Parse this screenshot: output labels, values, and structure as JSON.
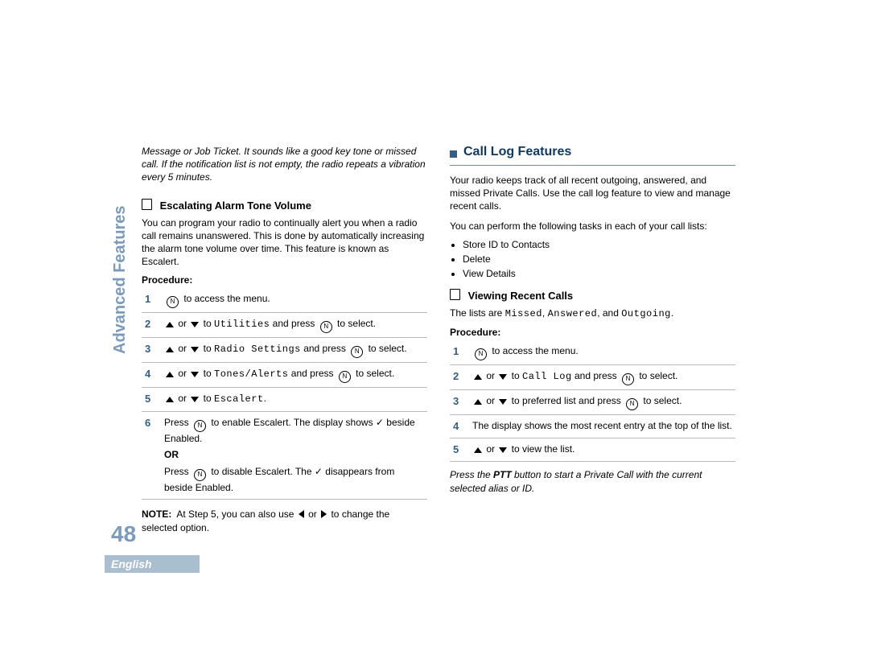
{
  "sideLabel": "Advanced Features",
  "pageNumber": "48",
  "languageTab": "English",
  "left": {
    "introNote": "Message or Job Ticket. It sounds like a good key tone or missed call. If the notification list is not empty, the radio repeats a vibration every 5 minutes.",
    "subHead": "Escalating Alarm Tone Volume",
    "body": "You can program your radio to continually alert you when a radio call remains unanswered. This is done by automatically increasing the alarm tone volume over time. This feature is known as Escalert.",
    "procLabel": "Procedure:",
    "steps": [
      {
        "n": "1",
        "pre": "",
        "icon1": "ok",
        "txt": " to access the menu."
      },
      {
        "n": "2",
        "pre": "",
        "arrows": true,
        "to": "Utilities",
        "press": true,
        "post": " to select."
      },
      {
        "n": "3",
        "pre": "",
        "arrows": true,
        "to": "Radio Settings",
        "press": true,
        "post": " to select."
      },
      {
        "n": "4",
        "pre": "",
        "arrows": true,
        "to": "Tones/Alerts",
        "press": true,
        "post": " to select."
      },
      {
        "n": "5",
        "pre": "",
        "arrows": true,
        "to": "Escalert",
        "press": false,
        "post": "."
      },
      {
        "n": "6",
        "row1a": "Press ",
        "row1b": " to enable Escalert. The display shows ",
        "row1c": " beside Enabled.",
        "or": "OR",
        "row2a": "Press ",
        "row2b": " to disable Escalert. The ",
        "row2c": " disappears from beside Enabled."
      }
    ],
    "noteLabel": "NOTE:",
    "noteText": "At Step 5, you can also use ",
    "noteText2": " or ",
    "noteText3": " to change the selected option."
  },
  "right": {
    "sectionHead": "Call Log Features",
    "body1": "Your radio keeps track of all recent outgoing, answered, and missed Private Calls. Use the call log feature to view and manage recent calls.",
    "body2": "You can perform the following tasks in each of your call lists:",
    "bullets": [
      "Store ID to Contacts",
      "Delete",
      "View Details"
    ],
    "subHead": "Viewing Recent Calls",
    "listsLine_a": "The lists are ",
    "listsLine_b": ", ",
    "listsLine_c": ", and ",
    "listsLine_d": ".",
    "mono1": "Missed",
    "mono2": "Answered",
    "mono3": "Outgoing",
    "procLabel": "Procedure:",
    "steps": [
      {
        "n": "1",
        "icon1": "ok",
        "txt": " to access the menu."
      },
      {
        "n": "2",
        "arrows": true,
        "to": "Call Log",
        "press": true,
        "post": " to select."
      },
      {
        "n": "3",
        "arrows": true,
        "plain": " to preferred list and press ",
        "press": true,
        "post": " to select."
      },
      {
        "n": "4",
        "plainOnly": "The display shows the most recent entry at the top of the list."
      },
      {
        "n": "5",
        "arrows": true,
        "plain": " to view the list."
      }
    ],
    "tailNote": "Press the PTT button to start a Private Call with the current selected alias or ID.",
    "tailBold": "PTT"
  }
}
